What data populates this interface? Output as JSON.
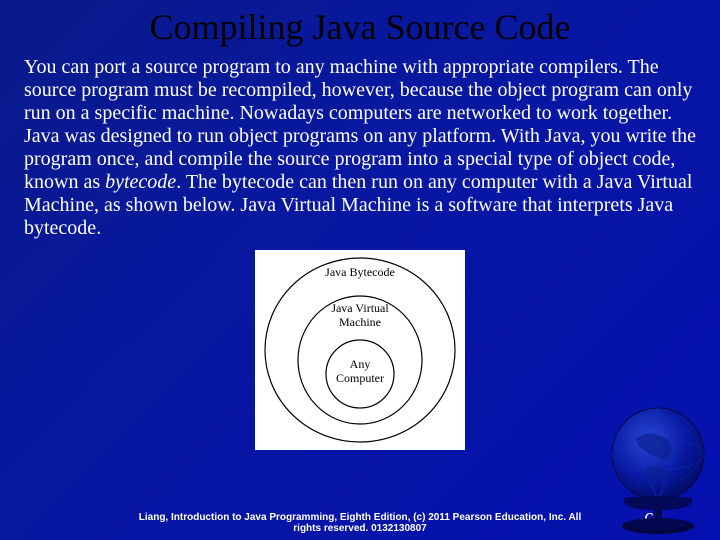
{
  "title": "Compiling Java Source Code",
  "paragraph_before_italic": "You can port a source program to any machine with appropriate compilers. The source program must be recompiled, however, because the object program can only run on a specific machine. Nowadays computers are networked to work together. Java was designed to run object programs on any platform. With Java, you write the program once, and compile the source program into a special type of object code, known as ",
  "italic_word": "bytecode",
  "paragraph_after_italic": ". The bytecode can then run on any computer with a Java Virtual Machine, as shown below. Java Virtual Machine is a software that interprets Java bytecode.",
  "diagram": {
    "outer_label": "Java Bytecode",
    "middle_label_line1": "Java Virtual",
    "middle_label_line2": "Machine",
    "inner_label_line1": "Any",
    "inner_label_line2": "Computer"
  },
  "footer_line1": "Liang, Introduction to Java Programming, Eighth Edition, (c) 2011 Pearson Education, Inc. All",
  "footer_line2": "rights reserved. 0132130807",
  "page_number": "64"
}
